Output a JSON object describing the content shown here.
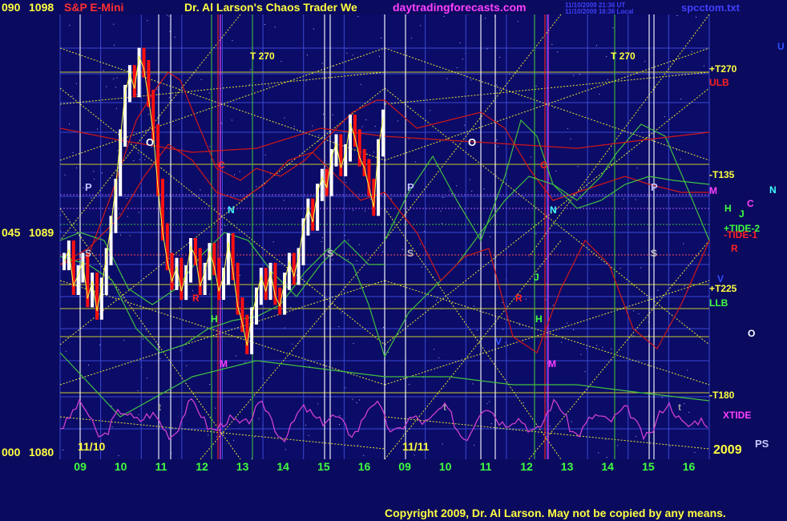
{
  "header": {
    "left_code": "090",
    "top_price": "1098",
    "instrument": "S&P E-Mini",
    "title": "Dr. Al Larson's Chaos Trader We",
    "website": "daytradingforecasts.com",
    "stamp1": "11/10/2009 21:36 UT",
    "stamp2": "11/10/2009 16:36 Local",
    "file": "spcctom.txt"
  },
  "left_axis": {
    "mid_code": "045",
    "mid_price": "1089",
    "bottom_code": "000",
    "bottom_price": "1080"
  },
  "date_labels": {
    "d1": "11/10",
    "d2": "11/11",
    "year": "2009"
  },
  "hour_ticks": [
    "09",
    "10",
    "11",
    "12",
    "13",
    "14",
    "15",
    "16",
    "09",
    "10",
    "11",
    "12",
    "13",
    "14",
    "15",
    "16"
  ],
  "right_labels": {
    "t270": "+T270",
    "ulb": "ULB",
    "t135": "-T135",
    "tide2": "+TIDE-2",
    "tide1": "-TIDE-1",
    "t225": "+T225",
    "llb": "LLB",
    "t180": "-T180",
    "xtide": "XTIDE",
    "m": "M",
    "c": "C",
    "n": "N",
    "h": "H",
    "j": "J",
    "r": "R",
    "v": "V",
    "u": "U",
    "o": "O",
    "ps": "PS"
  },
  "in_chart_labels": {
    "t270": "T  270",
    "P": "P",
    "O": "O",
    "C": "C",
    "N": "N",
    "S": "S",
    "R": "R",
    "H": "H",
    "M": "M",
    "J": "J",
    "V": "V",
    "t": "t"
  },
  "copyright": "Copyright 2009, Dr. Al Larson. May not be copied by any means.",
  "colors": {
    "background": "#0a0a5e",
    "white_bars": "#ffffff",
    "red_bars": "#ff1010",
    "red_channel": "#d01818",
    "green_channel": "#40c040",
    "yellow_grid": "#e8e830",
    "magenta_tide": "#d040d0",
    "grid_blue": "#3a4ad0"
  },
  "chart_data": {
    "type": "bar",
    "title": "S&P E-Mini",
    "x_axis": {
      "session1": "11/10",
      "session2": "11/11",
      "hours": [
        9,
        10,
        11,
        12,
        13,
        14,
        15,
        16
      ]
    },
    "y_axis": {
      "codes": [
        "090",
        "045",
        "000"
      ],
      "prices": [
        1098,
        1089,
        1080
      ],
      "ylim": [
        1080,
        1098
      ]
    },
    "price_series_11_10": [
      1088.0,
      1088.5,
      1087.0,
      1087.5,
      1088.0,
      1086.5,
      1087.2,
      1086.0,
      1087.0,
      1088.2,
      1089.5,
      1091.0,
      1093.0,
      1094.8,
      1095.6,
      1095.0,
      1096.3,
      1095.8,
      1094.6,
      1093.2,
      1091.0,
      1089.2,
      1088.0,
      1087.2,
      1087.8,
      1086.8,
      1087.5,
      1088.6,
      1088.2,
      1087.0,
      1087.6,
      1088.4,
      1087.8,
      1086.8,
      1087.4,
      1088.8,
      1087.6,
      1086.2,
      1085.5,
      1084.6,
      1085.8,
      1086.6,
      1087.4,
      1086.8,
      1087.6,
      1086.6,
      1086.2,
      1087.2,
      1088.0,
      1087.4,
      1088.2,
      1089.4,
      1090.2,
      1089.6,
      1090.8,
      1091.4,
      1091.0,
      1092.2,
      1092.8,
      1091.8,
      1092.4,
      1093.6,
      1093.0,
      1092.2,
      1091.8,
      1091.0,
      1090.2,
      1092.6,
      1093.8
    ],
    "overlay_series": [
      {
        "name": "ULB"
      },
      {
        "name": "LLB"
      },
      {
        "name": "+TIDE-2"
      },
      {
        "name": "-TIDE-1"
      },
      {
        "name": "XTIDE"
      }
    ]
  }
}
